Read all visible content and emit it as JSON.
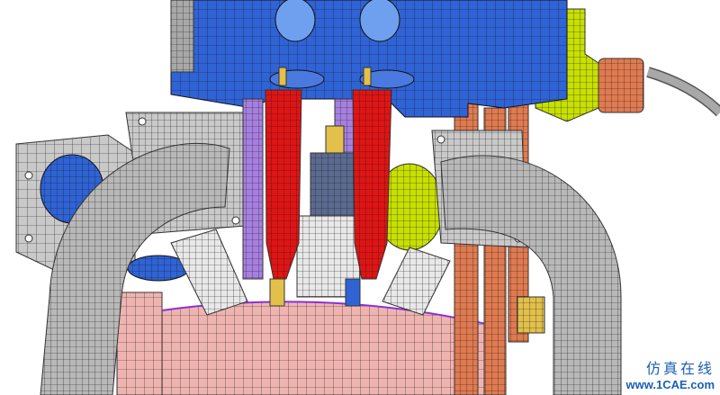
{
  "scene": {
    "subject": "engine-assembly-fe-mesh",
    "colors": {
      "block": "#2f63d6",
      "pipe": "#b8b8b8",
      "coil": "#e01414",
      "plug_insulator": "#e8e8e8",
      "plug_gold": "#e2c04a",
      "purple": "#a77fe0",
      "copper": "#e07a50",
      "pink": "#f0b4b0",
      "lime": "#c7e000",
      "flange": "#c9c9c9",
      "cable": "#a8a8a8",
      "mesh": "#1a1a1a"
    }
  },
  "watermark": {
    "line1": "仿真在线",
    "line2": "www.1CAE.com"
  }
}
